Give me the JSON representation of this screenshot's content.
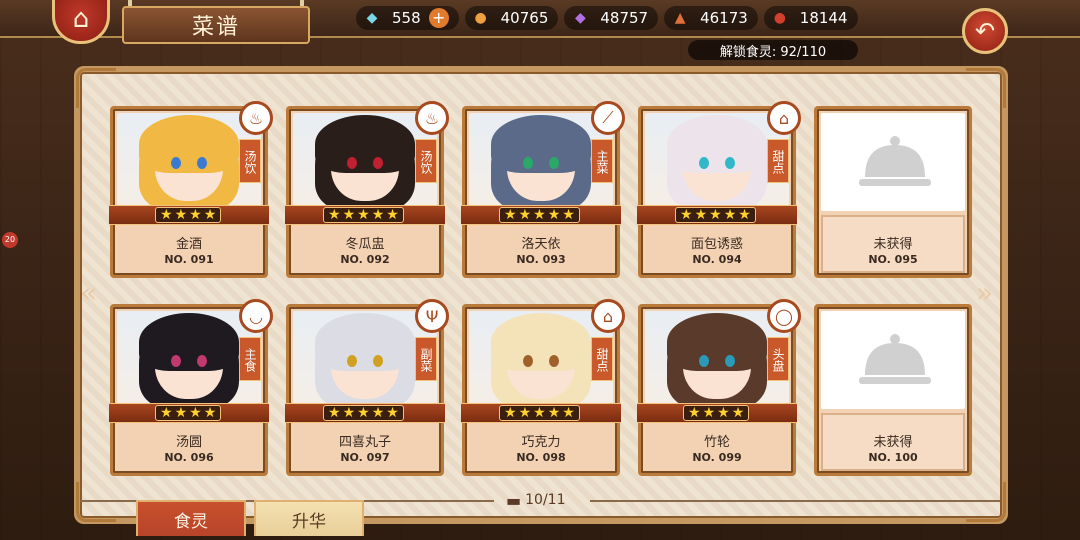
{
  "header": {
    "title": "菜谱",
    "unlock_text": "解锁食灵: 92/110"
  },
  "resources": [
    {
      "name": "diamond",
      "icon": "diamond-icon",
      "value": "558",
      "has_plus": true,
      "color": "#7ad7e8"
    },
    {
      "name": "juice",
      "icon": "potion-icon",
      "value": "40765",
      "has_plus": false,
      "color": "#f0a040"
    },
    {
      "name": "crystal",
      "icon": "crystal-icon",
      "value": "48757",
      "has_plus": false,
      "color": "#b070e0"
    },
    {
      "name": "meat",
      "icon": "meat-icon",
      "value": "46173",
      "has_plus": false,
      "color": "#e0703a"
    },
    {
      "name": "drum",
      "icon": "drum-icon",
      "value": "18144",
      "has_plus": false,
      "color": "#d0402a"
    }
  ],
  "side_badge": "20",
  "cards": [
    {
      "name": "金酒",
      "number": "NO. 091",
      "stars": 4,
      "type": "汤饮",
      "type_icon": "soup-bowl-icon",
      "hair": "#f2b844",
      "eyes": "#3a7ad0",
      "unlocked": true
    },
    {
      "name": "冬瓜盅",
      "number": "NO. 092",
      "stars": 5,
      "type": "汤饮",
      "type_icon": "soup-bowl-icon",
      "hair": "#2a1e1a",
      "eyes": "#c02030",
      "unlocked": true
    },
    {
      "name": "洛天依",
      "number": "NO. 093",
      "stars": 5,
      "type": "主菜",
      "type_icon": "knife-icon",
      "hair": "#5a6a88",
      "eyes": "#2aa868",
      "unlocked": true
    },
    {
      "name": "面包诱惑",
      "number": "NO. 094",
      "stars": 5,
      "type": "甜点",
      "type_icon": "cake-icon",
      "hair": "#ece4ea",
      "eyes": "#30b8c8",
      "unlocked": true
    },
    {
      "name": "未获得",
      "number": "NO. 095",
      "unlocked": false
    },
    {
      "name": "汤圆",
      "number": "NO. 096",
      "stars": 4,
      "type": "主食",
      "type_icon": "rice-bowl-icon",
      "hair": "#1e1a20",
      "eyes": "#c03a70",
      "unlocked": true
    },
    {
      "name": "四喜丸子",
      "number": "NO. 097",
      "stars": 5,
      "type": "副菜",
      "type_icon": "fork-icon",
      "hair": "#dcdce4",
      "eyes": "#d0a020",
      "unlocked": true
    },
    {
      "name": "巧克力",
      "number": "NO. 098",
      "stars": 5,
      "type": "甜点",
      "type_icon": "cake-icon",
      "hair": "#f4e2b8",
      "eyes": "#a0602a",
      "unlocked": true
    },
    {
      "name": "竹轮",
      "number": "NO. 099",
      "stars": 4,
      "type": "头盘",
      "type_icon": "plate-icon",
      "hair": "#5a3a2a",
      "eyes": "#2a9ab8",
      "unlocked": true
    },
    {
      "name": "未获得",
      "number": "NO. 100",
      "unlocked": false
    }
  ],
  "pager": {
    "text": "10/11"
  },
  "tabs": [
    {
      "label": "食灵",
      "active": true
    },
    {
      "label": "升华",
      "active": false
    }
  ],
  "colors": {
    "accent": "#a84a1f",
    "star": "#ffd22e",
    "active_tab": "#b8442a",
    "inactive_tab": "#e8cf9a"
  }
}
